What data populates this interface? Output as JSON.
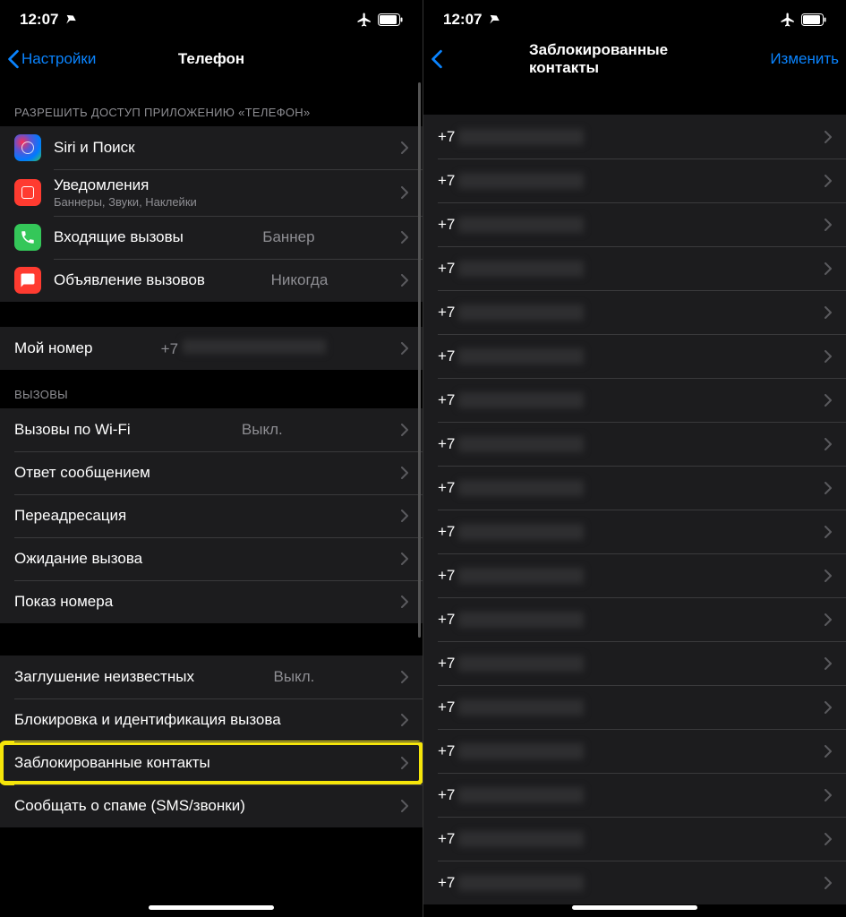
{
  "status": {
    "time": "12:07"
  },
  "left": {
    "nav": {
      "back": "Настройки",
      "title": "Телефон"
    },
    "section_access": "РАЗРЕШИТЬ ДОСТУП ПРИЛОЖЕНИЮ «ТЕЛЕФОН»",
    "rows_access": [
      {
        "label": "Siri и Поиск",
        "sub": "",
        "value": "",
        "icon": "siri"
      },
      {
        "label": "Уведомления",
        "sub": "Баннеры, Звуки, Наклейки",
        "value": "",
        "icon": "notifications"
      },
      {
        "label": "Входящие вызовы",
        "sub": "",
        "value": "Баннер",
        "icon": "incoming"
      },
      {
        "label": "Объявление вызовов",
        "sub": "",
        "value": "Никогда",
        "icon": "announce"
      }
    ],
    "my_number": {
      "label": "Мой номер",
      "prefix": "+7"
    },
    "section_calls": "ВЫЗОВЫ",
    "rows_calls": [
      {
        "label": "Вызовы по Wi-Fi",
        "value": "Выкл."
      },
      {
        "label": "Ответ сообщением",
        "value": ""
      },
      {
        "label": "Переадресация",
        "value": ""
      },
      {
        "label": "Ожидание вызова",
        "value": ""
      },
      {
        "label": "Показ номера",
        "value": ""
      }
    ],
    "rows_block": [
      {
        "label": "Заглушение неизвестных",
        "value": "Выкл."
      },
      {
        "label": "Блокировка и идентификация вызова",
        "value": ""
      },
      {
        "label": "Заблокированные контакты",
        "value": "",
        "highlight": true
      },
      {
        "label": "Сообщать о спаме (SMS/звонки)",
        "value": ""
      }
    ]
  },
  "right": {
    "nav": {
      "title": "Заблокированные контакты",
      "action": "Изменить"
    },
    "prefix": "+7",
    "count": 18
  }
}
